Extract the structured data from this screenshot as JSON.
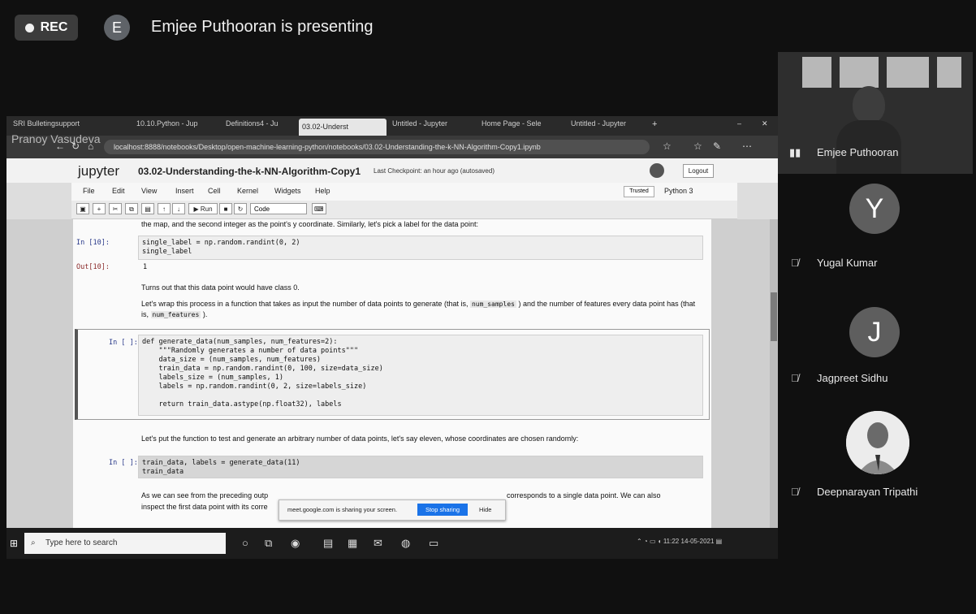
{
  "meeting": {
    "rec_label": "REC",
    "presenter_initial": "E",
    "presenting_text": "Emjee Puthooran is presenting"
  },
  "browser": {
    "tabs": [
      "SRI Bulletingsupport",
      "10.10.Python - Jup",
      "Definitions4 - Ju",
      "03.02-Underst",
      "Untitled - Jupyter",
      "Home Page - Sele",
      "Untitled - Jupyter"
    ],
    "url": "localhost:8888/notebooks/Desktop/open-machine-learning-python/notebooks/03.02-Understanding-the-k-NN-Algorithm-Copy1.ipynb",
    "ghost_name": "Pranoy Vasudeva"
  },
  "jupyter": {
    "logo": "jupyter",
    "title": "03.02-Understanding-the-k-NN-Algorithm-Copy1",
    "checkpoint": "Last Checkpoint: an hour ago  (autosaved)",
    "logout": "Logout",
    "menu": [
      "File",
      "Edit",
      "View",
      "Insert",
      "Cell",
      "Kernel",
      "Widgets",
      "Help"
    ],
    "trusted": "Trusted",
    "kernel": "Python 3",
    "toolbar_run": "Run",
    "cell_type": "Code"
  },
  "notebook": {
    "md1": "the map, and the second integer as the point's y coordinate. Similarly, let's pick a label for the data point:",
    "in10_prompt": "In [10]:",
    "in10_code": "single_label = np.random.randint(0, 2)\nsingle_label",
    "out10_prompt": "Out[10]:",
    "out10_value": "1",
    "md2": "Turns out that this data point would have class 0.",
    "md3_a": "Let's wrap this process in a function that takes as input the number of data points to generate (that is,",
    "md3_code1": "num_samples",
    "md3_b": ") and the number of features every data point has (that is,",
    "md3_code2": "num_features",
    "md3_c": ").",
    "in_gen_prompt": "In [ ]:",
    "in_gen_code": "def generate_data(num_samples, num_features=2):\n    \"\"\"Randomly generates a number of data points\"\"\"\n    data_size = (num_samples, num_features)\n    train_data = np.random.randint(0, 100, size=data_size)\n    labels_size = (num_samples, 1)\n    labels = np.random.randint(0, 2, size=labels_size)\n\n    return train_data.astype(np.float32), labels",
    "md4": "Let's put the function to test and generate an arbitrary number of data points, let's say eleven, whose coordinates are chosen randomly:",
    "in_call_prompt": "In [ ]:",
    "in_call_code": "train_data, labels = generate_data(11)\ntrain_data",
    "md5_a": "As we can see from the preceding outp",
    "md5_b": "corresponds to a single data point. We can also",
    "md5_c": "inspect the first data point with its corre"
  },
  "share_bar": {
    "text": "meet.google.com is sharing your screen.",
    "stop": "Stop sharing",
    "hide": "Hide"
  },
  "taskbar": {
    "search_placeholder": "Type here to search",
    "time": "11:22",
    "date": "14-05-2021"
  },
  "participants": [
    {
      "name": "Emjee Puthooran",
      "type": "video"
    },
    {
      "name": "Yugal Kumar",
      "initial": "Y",
      "muted": true
    },
    {
      "name": "Jagpreet Sidhu",
      "initial": "J",
      "muted": true
    },
    {
      "name": "Deepnarayan Tripathi",
      "type": "photo",
      "muted": true
    }
  ]
}
